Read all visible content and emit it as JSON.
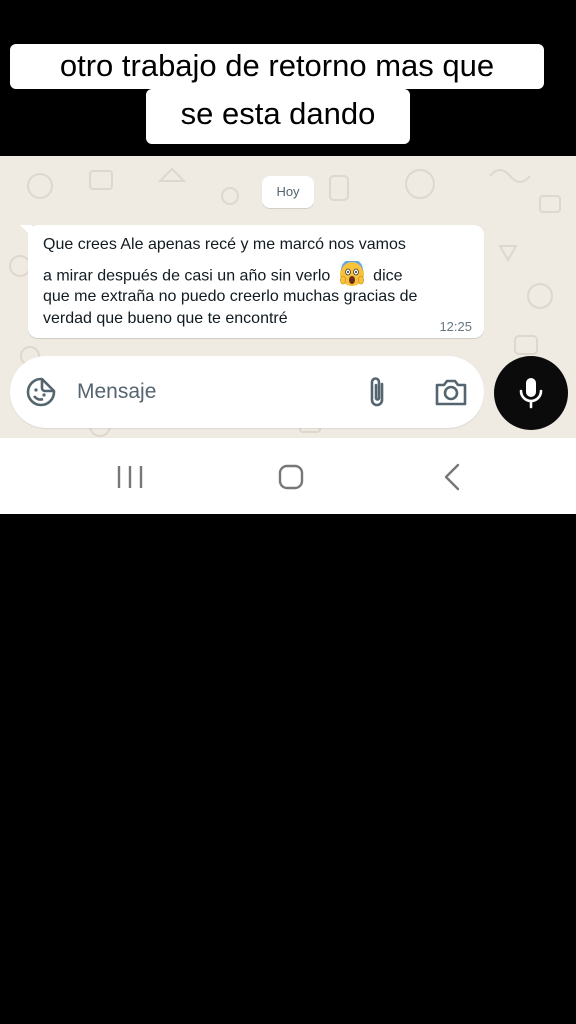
{
  "caption": {
    "line1": "otro trabajo de retorno mas que",
    "line2": "se esta dando"
  },
  "chat": {
    "day_label": "Hoy",
    "message": {
      "line1": "Que crees Ale apenas recé y me marcó nos vamos",
      "line2_before_emoji": "a mirar después de casi un año sin verlo",
      "emoji": "face-screaming-in-fear",
      "line2_after_emoji": "dice",
      "line3": "que me extraña no puedo creerlo muchas gracias de",
      "line4": "verdad que bueno que te encontré",
      "time": "12:25"
    }
  },
  "input": {
    "placeholder": "Mensaje",
    "icons": [
      "sticker-icon",
      "paperclip-icon",
      "camera-icon",
      "microphone-icon"
    ]
  },
  "navbar": {
    "icons": [
      "recents-icon",
      "home-icon",
      "back-icon"
    ]
  },
  "colors": {
    "chat_background": "#efeae2",
    "bubble": "#ffffff",
    "icon_gray": "#54656f",
    "mic_button": "#0b0b0b"
  }
}
